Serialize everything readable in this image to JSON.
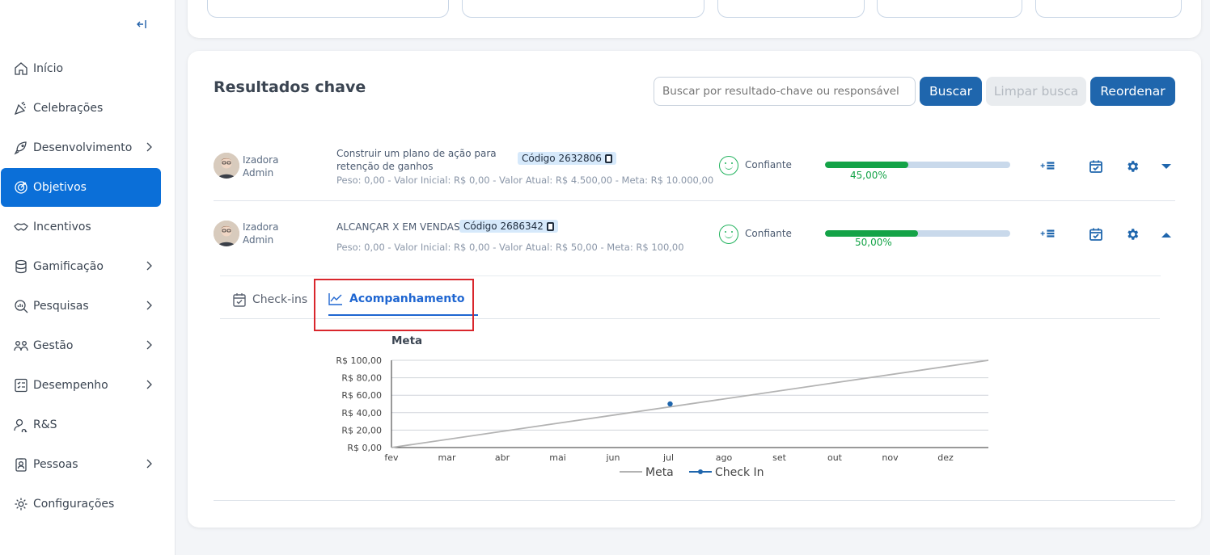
{
  "sidebar": {
    "items": [
      {
        "label": "Início",
        "icon": "home-icon",
        "has_children": false,
        "active": false
      },
      {
        "label": "Celebrações",
        "icon": "party-icon",
        "has_children": false,
        "active": false
      },
      {
        "label": "Desenvolvimento",
        "icon": "rocket-icon",
        "has_children": true,
        "active": false
      },
      {
        "label": "Objetivos",
        "icon": "target-icon",
        "has_children": false,
        "active": true
      },
      {
        "label": "Incentivos",
        "icon": "handshake-icon",
        "has_children": false,
        "active": false
      },
      {
        "label": "Gamificação",
        "icon": "coins-icon",
        "has_children": true,
        "active": false
      },
      {
        "label": "Pesquisas",
        "icon": "search-chart-icon",
        "has_children": true,
        "active": false
      },
      {
        "label": "Gestão",
        "icon": "people-icon",
        "has_children": true,
        "active": false
      },
      {
        "label": "Desempenho",
        "icon": "checklist-icon",
        "has_children": true,
        "active": false
      },
      {
        "label": "R&S",
        "icon": "user-search-icon",
        "has_children": false,
        "active": false
      },
      {
        "label": "Pessoas",
        "icon": "id-badge-icon",
        "has_children": true,
        "active": false
      },
      {
        "label": "Configurações",
        "icon": "gear-icon",
        "has_children": false,
        "active": false
      }
    ]
  },
  "section": {
    "title": "Resultados chave",
    "search_placeholder": "Buscar por resultado-chave ou responsável",
    "search_button": "Buscar",
    "clear_button": "Limpar busca",
    "reorder_button": "Reordenar"
  },
  "key_results": [
    {
      "owner_first": "Izadora",
      "owner_last": "Admin",
      "name_line1": "Construir um plano de ação para",
      "name_line2": "retenção de ganhos",
      "code": "Código 2632806",
      "meta_line": "Peso: 0,00 -  Valor Inicial: R$ 0,00  -   Valor Atual: R$ 4.500,00  -   Meta: R$ 10.000,00",
      "confidence": "Confiante",
      "progress": 0.45,
      "progress_label": "45,00%",
      "expanded": false
    },
    {
      "owner_first": "Izadora",
      "owner_last": "Admin",
      "name_line1": "ALCANÇAR X EM VENDAS",
      "name_line2": "",
      "code": "Código 2686342",
      "meta_line": "Peso: 0,00 -  Valor Inicial: R$ 0,00  -   Valor Atual: R$ 50,00  -   Meta: R$ 100,00",
      "confidence": "Confiante",
      "progress": 0.5,
      "progress_label": "50,00%",
      "expanded": true
    }
  ],
  "tabs": {
    "checkins": "Check-ins",
    "acompanhamento": "Acompanhamento"
  },
  "colors": {
    "primary": "#1f66ad",
    "active_nav": "#0b6fd8",
    "success": "#14a347",
    "highlight": "#d9262c",
    "meta_line": "#b3b3b3",
    "checkin_point": "#1f66ad"
  },
  "chart_data": {
    "type": "line",
    "title": "Meta",
    "x": [
      "fev",
      "mar",
      "abr",
      "mai",
      "jun",
      "jul",
      "ago",
      "set",
      "out",
      "nov",
      "dez"
    ],
    "ytick_labels": [
      "R$ 0,00",
      "R$ 20,00",
      "R$ 40,00",
      "R$ 60,00",
      "R$ 80,00",
      "R$ 100,00"
    ],
    "ylim": [
      0,
      100
    ],
    "grid": true,
    "legend": "bottom",
    "series": [
      {
        "name": "Meta",
        "type": "line",
        "color": "#b3b3b3",
        "points": [
          [
            "fev",
            0
          ],
          [
            "dez+",
            100
          ]
        ]
      },
      {
        "name": "Check In",
        "type": "point",
        "color": "#1f66ad",
        "points": [
          [
            "jul",
            50
          ]
        ]
      }
    ]
  }
}
